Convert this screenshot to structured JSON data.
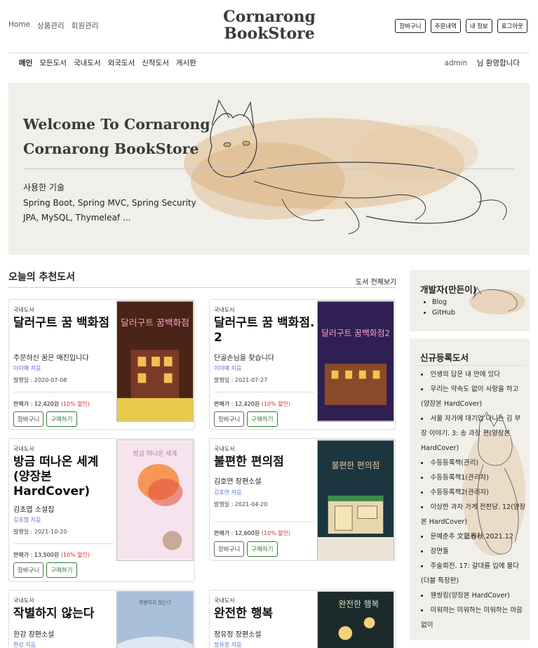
{
  "header": {
    "top_links": [
      "Home",
      "상품관리",
      "회원관리"
    ],
    "logo_line1": "Cornarong",
    "logo_line2": "BookStore",
    "buttons": [
      "장바구니",
      "주문내역",
      "내 정보",
      "로그아웃"
    ]
  },
  "nav": {
    "items": [
      "메인",
      "모든도서",
      "국내도서",
      "외국도서",
      "신작도서",
      "게시판"
    ],
    "user_name": "admin",
    "welcome": "님 환영합니다"
  },
  "hero": {
    "title_line1": "Welcome To Cornarong",
    "title_line2": "Cornarong BookStore",
    "tech_label": "사용한 기술",
    "tech_line1": "Spring Boot, Spring MVC, Spring Security",
    "tech_line2": "JPA, MySQL, Thymeleaf ..."
  },
  "recommend": {
    "title": "오늘의 추천도서",
    "view_all": "도서 전체보기",
    "books": [
      {
        "category": "국내도서",
        "title": "달러구트 꿈 백화점",
        "subtitle": "주문하신 꿈은 매진입니다",
        "author": "이미예 지음",
        "pub": "발행일 : 2020-07-08",
        "price": "판매가 : 12,420원",
        "discount": "(10% 할인)",
        "cover_text": "달러구트 꿈백화점",
        "cover_color": "#5a2b1f"
      },
      {
        "category": "국내도서",
        "title": "달러구트 꿈 백화점. 2",
        "subtitle": "단골손님을 찾습니다",
        "author": "이미예 지음",
        "pub": "발행일 : 2021-07-27",
        "price": "판매가 : 12,420원",
        "discount": "(10% 할인)",
        "cover_text": "달러구트 꿈백화점2",
        "cover_color": "#3a2459"
      },
      {
        "category": "국내도서",
        "title": "방금 떠나온 세계 (양장본 HardCover)",
        "subtitle": "김초엽 소설집",
        "author": "김초엽 지음",
        "pub": "발행일 : 2021-10-20",
        "price": "판매가 : 13,500원",
        "discount": "(10% 할인)",
        "cover_text": "방금 떠나온 세계",
        "cover_color": "#f4d9e6"
      },
      {
        "category": "국내도서",
        "title": "불편한 편의점",
        "subtitle": "김호연 장편소설",
        "author": "김호연 지음",
        "pub": "발행일 : 2021-04-20",
        "price": "판매가 : 12,600원",
        "discount": "(10% 할인)",
        "cover_text": "불편한 편의점",
        "cover_color": "#1f3b44"
      },
      {
        "category": "국내도서",
        "title": "작별하지 않는다",
        "subtitle": "한강 장편소설",
        "author": "한강 지음",
        "pub": "",
        "price": "",
        "discount": "",
        "cover_text": "작별하지 않는다",
        "cover_color": "#a9bfd8"
      },
      {
        "category": "국내도서",
        "title": "완전한 행복",
        "subtitle": "정유정 장편소설",
        "author": "정유정 지음",
        "pub": "",
        "price": "",
        "discount": "",
        "cover_text": "완전한 행복",
        "cover_color": "#1d2a2c"
      }
    ],
    "cart_label": "장바구니",
    "buy_label": "구매하기"
  },
  "sidebar": {
    "dev_title": "개발자(만든이)",
    "dev_links": [
      "Blog",
      "GitHub"
    ],
    "new_title": "신규등록도서",
    "new_books": [
      "인생의 답은 내 안에 있다",
      "우리는 약속도 없이 사랑을 하고(양장본 HardCover)",
      "서울 자가에 대기업 다니는 김 부장 이야기. 3: 송 과장 편(양장본 HardCover)",
      "수등등록책(관리)",
      "수등등록책1(관리자)",
      "수등등록책2(관리자)",
      "이상한 과자 가게 전천당. 12(양장본 HardCover)",
      "문예춘추 文藝春秋 2021.12",
      "장면들",
      "주술회전. 17: 갈대를 입에 물다(더블 특장판)",
      "웬씽킹(양장본 HardCover)",
      "미워하는 미워하는 미워하는 마음 없이"
    ]
  }
}
